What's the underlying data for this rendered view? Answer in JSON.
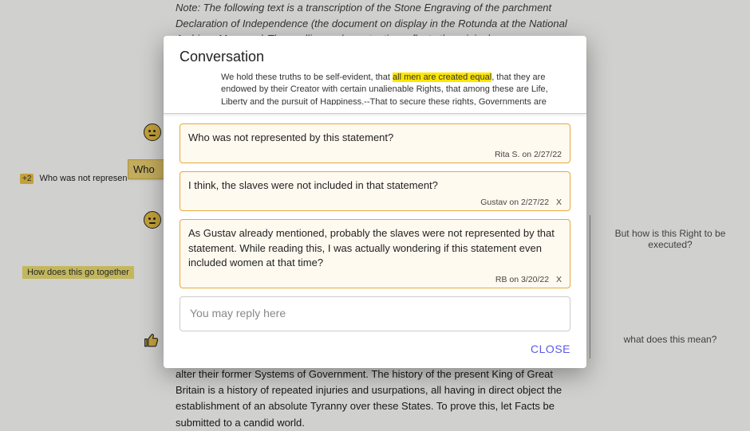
{
  "background": {
    "note": "Note: The following text is a transcription of the Stone Engraving of the parchment Declaration of Independence (the document on display in the Rotunda at the National Archives Museum.) The spelling and punctuation reflects the original.",
    "bottom_para": "sufferance of these Colonies; and such is now the necessity which constrains them to alter their former Systems of Government. The history of the present King of Great Britain is a history of repeated injuries and usurpations, all having in direct object the establishment of an absolute Tyranny over these States. To prove this, let Facts be submitted to a candid world."
  },
  "left": {
    "badge": "+2",
    "note1": "Who was not represen",
    "sticky": "Who",
    "hl2": "How does this go together"
  },
  "right": {
    "note_top": "But how is this Right to be executed?",
    "note_bottom": "what does this mean?"
  },
  "modal": {
    "title": "Conversation",
    "context_pre": "We hold these truths to be self-evident, that ",
    "context_hl": "all men are created equal",
    "context_post": ", that they are endowed by their Creator with certain unalienable Rights, that among these are Life, Liberty and the pursuit of Happiness.--That to secure these rights, Governments are instituted among Men, deriving their just powers from the consent of the governed, --That whenever",
    "comments": [
      {
        "text": "Who was not represented by this statement?",
        "meta": "Rita S. on 2/27/22",
        "deletable": false
      },
      {
        "text": "I think, the slaves were not included in that statement?",
        "meta": "Gustav on 2/27/22",
        "deletable": true
      },
      {
        "text": "As Gustav already mentioned, probably the slaves were not represented by that statement. While reading this, I was actually wondering if this statement even included women at that time?",
        "meta": "RB on 3/20/22",
        "deletable": true
      }
    ],
    "reply_placeholder": "You may reply here",
    "close": "CLOSE"
  }
}
